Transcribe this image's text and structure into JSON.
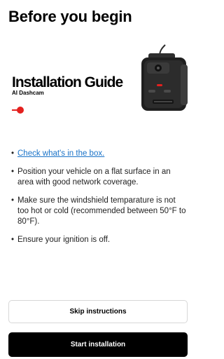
{
  "header": {
    "title": "Before you begin"
  },
  "hero": {
    "title": "Installation Guide",
    "subtitle": "AI Dashcam",
    "brand_color": "#e4201e",
    "device_icon": "dashcam-device-image"
  },
  "checklist": {
    "items": [
      "Check what's in the box.",
      "Position your vehicle on a flat surface in an area with good network coverage.",
      "Make sure the windshield temparature is not too hot or cold (recommended between 50°F to 80°F).",
      "Ensure your ignition is off."
    ]
  },
  "actions": {
    "skip_label": "Skip instructions",
    "start_label": "Start installation"
  },
  "colors": {
    "link": "#1a73c8",
    "primary_button": "#000000",
    "accent": "#e4201e"
  }
}
